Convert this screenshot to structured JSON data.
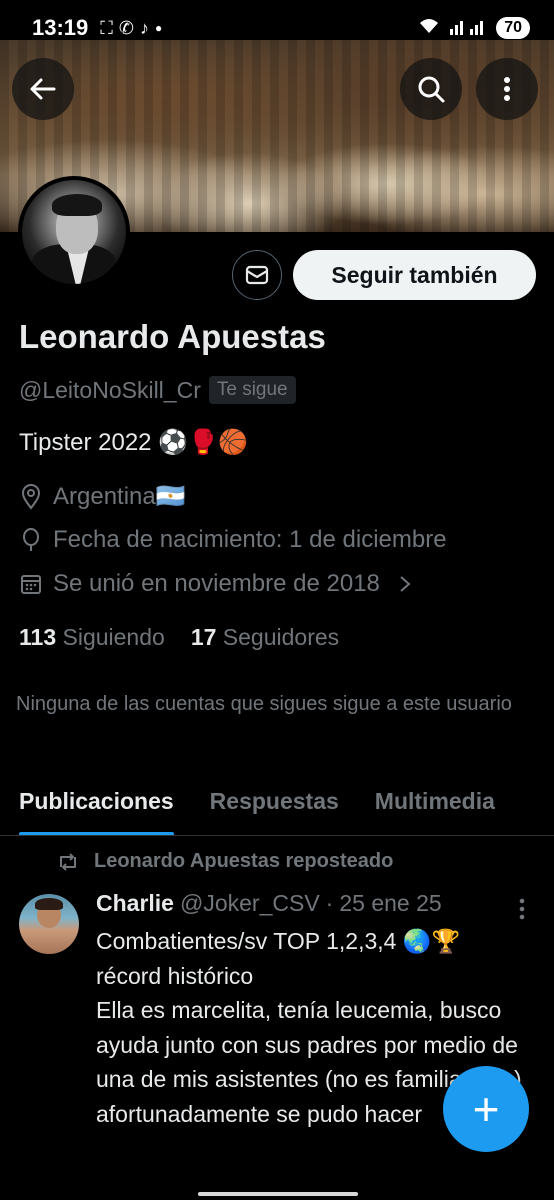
{
  "status_bar": {
    "time": "13:19",
    "battery": "70",
    "icons": [
      "screenshot-icon",
      "whatsapp-icon",
      "tiktok-icon",
      "dot-icon",
      "wifi-icon",
      "signal-icon"
    ]
  },
  "header": {
    "back_icon": "arrow-left-icon",
    "search_icon": "search-icon",
    "more_icon": "more-vertical-icon"
  },
  "profile": {
    "name": "Leonardo Apuestas",
    "handle": "@LeitoNoSkill_Cr",
    "follows_you": "Te sigue",
    "bio": "Tipster 2022 ⚽🥊🏀",
    "location": "Argentina🇦🇷",
    "birthday": "Fecha de nacimiento: 1 de diciembre",
    "joined": "Se unió en noviembre de 2018",
    "following_count": "113",
    "following_label": "Siguiendo",
    "followers_count": "17",
    "followers_label": "Seguidores",
    "mutuals_note": "Ninguna de las cuentas que sigues sigue a este usuario",
    "follow_back_label": "Seguir también"
  },
  "tabs": [
    {
      "label": "Publicaciones",
      "active": true
    },
    {
      "label": "Respuestas",
      "active": false
    },
    {
      "label": "Multimedia",
      "active": false
    }
  ],
  "post": {
    "repost_label": "Leonardo Apuestas reposteado",
    "author_name": "Charlie",
    "author_handle": "@Joker_CSV",
    "separator": "·",
    "date": "25 ene 25",
    "text": "Combatientes/sv TOP 1,2,3,4 🌏🏆\nrécord histórico\nElla es marcelita, tenía leucemia, busco ayuda junto con sus padres por medio de una de mis asistentes (no es familiar mío)\nafortunadamente se pudo hacer"
  },
  "fab": {
    "label": "+"
  },
  "colors": {
    "accent": "#1d9bf0",
    "background": "#000000",
    "text_primary": "#e7e9ea",
    "text_secondary": "#71767b",
    "button_bg": "#eff3f4"
  }
}
